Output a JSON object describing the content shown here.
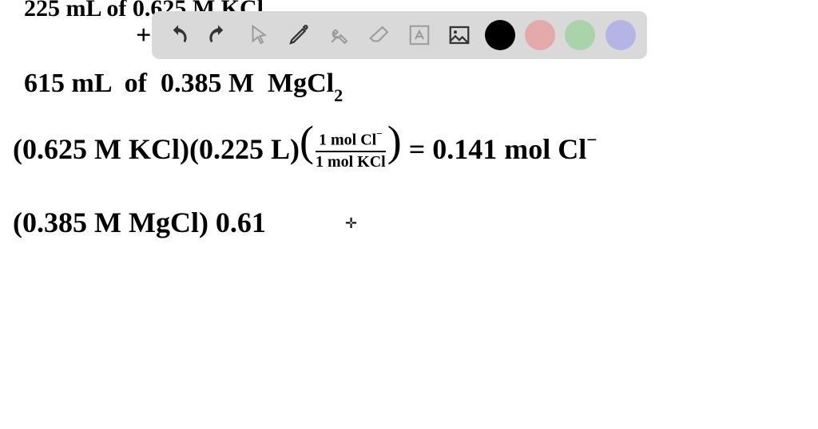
{
  "toolbar": {
    "undo_icon": "undo-icon",
    "redo_icon": "redo-icon",
    "pointer_icon": "pointer-icon",
    "pen_icon": "pen-icon",
    "tools_icon": "tools-icon",
    "eraser_icon": "eraser-icon",
    "text_icon": "text-icon",
    "image_icon": "image-icon",
    "colors": {
      "black": "#000000",
      "pink": "#e4a9a9",
      "green": "#a9d4a9",
      "purple": "#b4b4e6"
    }
  },
  "content": {
    "line1": "225 mL  of  0.625 M  KCl",
    "plus": "+",
    "line2": "615 mL  of  0.385 M  MgCl₂",
    "calc1_lhs_a": "(0.625 M KCl)",
    "calc1_lhs_b": "(0.225 L)",
    "calc1_frac_num": "1 mol Cl⁻",
    "calc1_frac_den": "1 mol KCl",
    "calc1_eq": " = ",
    "calc1_rhs": "0.141 mol Cl⁻",
    "calc2": "(0.385 M MgCl)  0.61"
  }
}
